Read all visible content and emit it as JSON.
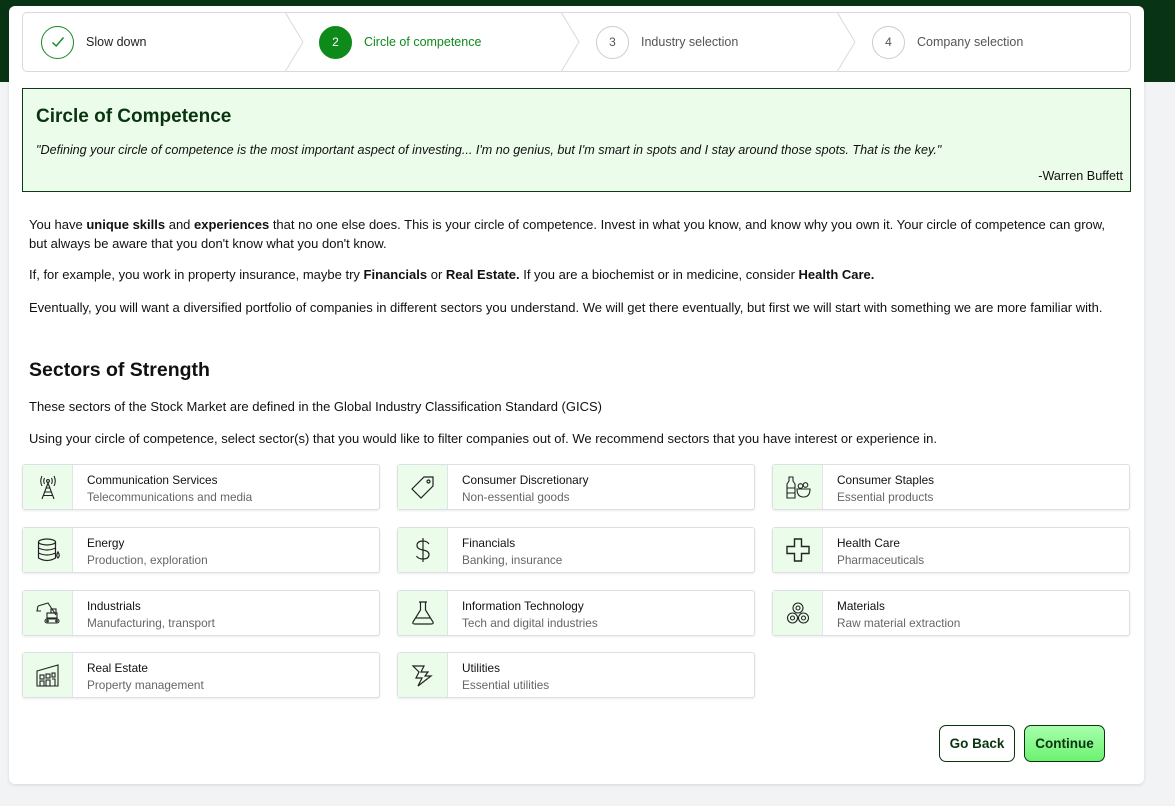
{
  "stepper": {
    "steps": [
      {
        "num": "",
        "label": "Slow down",
        "state": "done"
      },
      {
        "num": "2",
        "label": "Circle of competence",
        "state": "active"
      },
      {
        "num": "3",
        "label": "Industry selection",
        "state": "upcoming"
      },
      {
        "num": "4",
        "label": "Company selection",
        "state": "upcoming"
      }
    ]
  },
  "quote": {
    "title": "Circle of Competence",
    "text": "\"Defining your circle of competence is the most important aspect of investing... I'm no genius, but I'm smart in spots and I stay around those spots. That is the key.\"",
    "author": "-Warren Buffett"
  },
  "intro": {
    "p1_a": "You have ",
    "p1_b": "unique skills",
    "p1_c": " and ",
    "p1_d": "experiences",
    "p1_e": " that no one else does. This is your circle of competence. Invest in what you know, and know why you own it. Your circle of competence can grow, but always be aware that you don't know what you don't know.",
    "p2_a": "If, for example, you work in property insurance, maybe try ",
    "p2_b": "Financials",
    "p2_c": " or ",
    "p2_d": "Real Estate.",
    "p2_e": " If you are a biochemist or in medicine, consider ",
    "p2_f": "Health Care.",
    "p3": "Eventually, you will want a diversified portfolio of companies in different sectors you understand. We will get there eventually, but first we will start with something we are more familiar with."
  },
  "sectors_section": {
    "heading": "Sectors of Strength",
    "desc1": "These sectors of the Stock Market are defined in the Global Industry Classification Standard (GICS)",
    "desc2": "Using your circle of competence, select sector(s) that you would like to filter companies out of. We recommend sectors that you have interest or experience in."
  },
  "sectors": [
    {
      "name": "Communication Services",
      "sub": "Telecommunications and media",
      "icon": "antenna-tower-icon"
    },
    {
      "name": "Consumer Discretionary",
      "sub": "Non-essential goods",
      "icon": "price-tag-icon"
    },
    {
      "name": "Consumer Staples",
      "sub": "Essential products",
      "icon": "grocery-icon"
    },
    {
      "name": "Energy",
      "sub": "Production, exploration",
      "icon": "oil-barrel-icon"
    },
    {
      "name": "Financials",
      "sub": "Banking, insurance",
      "icon": "dollar-sign-icon"
    },
    {
      "name": "Health Care",
      "sub": "Pharmaceuticals",
      "icon": "medical-cross-icon"
    },
    {
      "name": "Industrials",
      "sub": "Manufacturing, transport",
      "icon": "excavator-icon"
    },
    {
      "name": "Information Technology",
      "sub": "Tech and digital industries",
      "icon": "flask-icon"
    },
    {
      "name": "Materials",
      "sub": "Raw material extraction",
      "icon": "material-rolls-icon"
    },
    {
      "name": "Real Estate",
      "sub": "Property management",
      "icon": "building-icon"
    },
    {
      "name": "Utilities",
      "sub": "Essential utilities",
      "icon": "lightning-icon"
    }
  ],
  "buttons": {
    "back": "Go Back",
    "continue": "Continue"
  },
  "colors": {
    "brand_dark": "#093315",
    "accent_green": "#0e8a1a",
    "light_green": "#ebfdea"
  }
}
